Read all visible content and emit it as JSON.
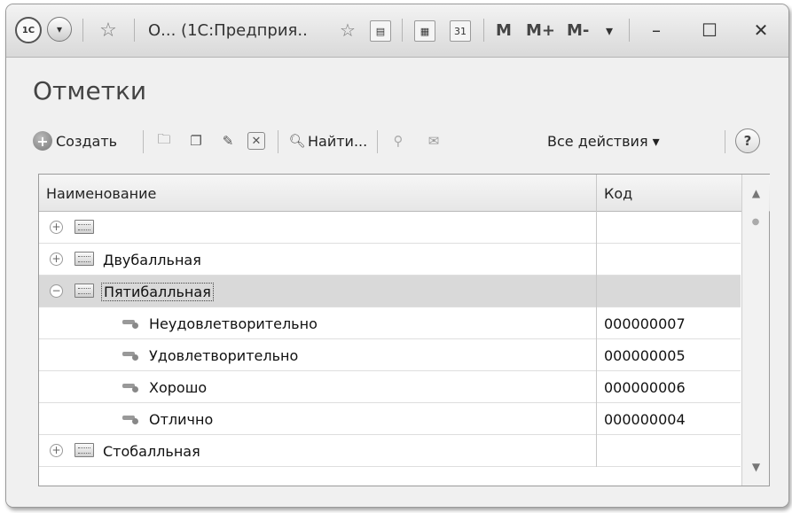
{
  "titlebar": {
    "logo": "1С",
    "title": "О... (1С:Предприя..",
    "m": "M",
    "m_plus": "M+",
    "m_minus": "M-",
    "dropdown": "▾",
    "minimize": "–",
    "maximize": "☐",
    "close": "✕"
  },
  "form": {
    "title": "Отметки"
  },
  "toolbar": {
    "create_label": "Создать",
    "find_label": "Найти...",
    "all_actions_label": "Все действия ▾",
    "help_label": "?"
  },
  "table": {
    "columns": [
      "Наименование",
      "Код"
    ],
    "rows": [
      {
        "type": "group",
        "expander": "+",
        "name": "",
        "code": ""
      },
      {
        "type": "group",
        "expander": "+",
        "name": "Двубалльная",
        "code": ""
      },
      {
        "type": "group",
        "expander": "−",
        "name": "Пятибалльная",
        "code": "",
        "selected": true
      },
      {
        "type": "item",
        "name": "Неудовлетворительно",
        "code": "000000007"
      },
      {
        "type": "item",
        "name": "Удовлетворительно",
        "code": "000000005"
      },
      {
        "type": "item",
        "name": "Хорошо",
        "code": "000000006"
      },
      {
        "type": "item",
        "name": "Отлично",
        "code": "000000004"
      },
      {
        "type": "group",
        "expander": "+",
        "name": "Стобалльная",
        "code": ""
      }
    ]
  },
  "icons": {
    "menu": "chevron-down-icon",
    "favorite": "star-icon",
    "add_to_favorites": "star-add-icon",
    "history": "history-icon",
    "calculator": "calculator-icon",
    "calendar": "calendar-icon",
    "calendar_text": "31"
  }
}
